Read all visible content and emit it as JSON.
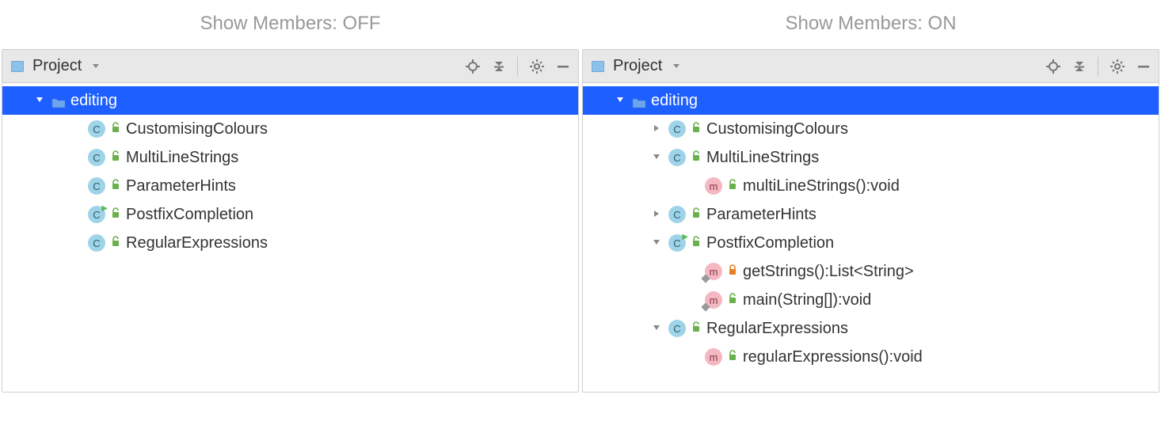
{
  "left": {
    "title": "Show Members: OFF",
    "header": {
      "label": "Project"
    },
    "rows": [
      {
        "arrow": "down",
        "type": "folder",
        "label": "editing",
        "selected": true,
        "indent": 1
      },
      {
        "arrow": "none",
        "type": "class",
        "run": false,
        "vis": "public",
        "label": "CustomisingColours",
        "indent": 2
      },
      {
        "arrow": "none",
        "type": "class",
        "run": false,
        "vis": "public",
        "label": "MultiLineStrings",
        "indent": 2
      },
      {
        "arrow": "none",
        "type": "class",
        "run": false,
        "vis": "public",
        "label": "ParameterHints",
        "indent": 2
      },
      {
        "arrow": "none",
        "type": "class",
        "run": true,
        "vis": "public",
        "label": "PostfixCompletion",
        "indent": 2
      },
      {
        "arrow": "none",
        "type": "class",
        "run": false,
        "vis": "public",
        "label": "RegularExpressions",
        "indent": 2
      }
    ]
  },
  "right": {
    "title": "Show Members: ON",
    "header": {
      "label": "Project"
    },
    "rows": [
      {
        "arrow": "down",
        "type": "folder",
        "label": "editing",
        "selected": true,
        "indent": 1
      },
      {
        "arrow": "right",
        "type": "class",
        "run": false,
        "vis": "public",
        "label": "CustomisingColours",
        "indent": 2
      },
      {
        "arrow": "down",
        "type": "class",
        "run": false,
        "vis": "public",
        "label": "MultiLineStrings",
        "indent": 2
      },
      {
        "arrow": "none",
        "type": "method",
        "static": false,
        "vis": "public",
        "label": "multiLineStrings():void",
        "indent": 3
      },
      {
        "arrow": "right",
        "type": "class",
        "run": false,
        "vis": "public",
        "label": "ParameterHints",
        "indent": 2
      },
      {
        "arrow": "down",
        "type": "class",
        "run": true,
        "vis": "public",
        "label": "PostfixCompletion",
        "indent": 2
      },
      {
        "arrow": "none",
        "type": "method",
        "static": true,
        "vis": "private",
        "label": "getStrings():List<String>",
        "indent": 3
      },
      {
        "arrow": "none",
        "type": "method",
        "static": true,
        "vis": "public",
        "label": "main(String[]):void",
        "indent": 3
      },
      {
        "arrow": "down",
        "type": "class",
        "run": false,
        "vis": "public",
        "label": "RegularExpressions",
        "indent": 2
      },
      {
        "arrow": "none",
        "type": "method",
        "static": false,
        "vis": "public",
        "label": "regularExpressions():void",
        "indent": 3
      }
    ]
  },
  "glyphs": {
    "class": "C",
    "method": "m"
  }
}
